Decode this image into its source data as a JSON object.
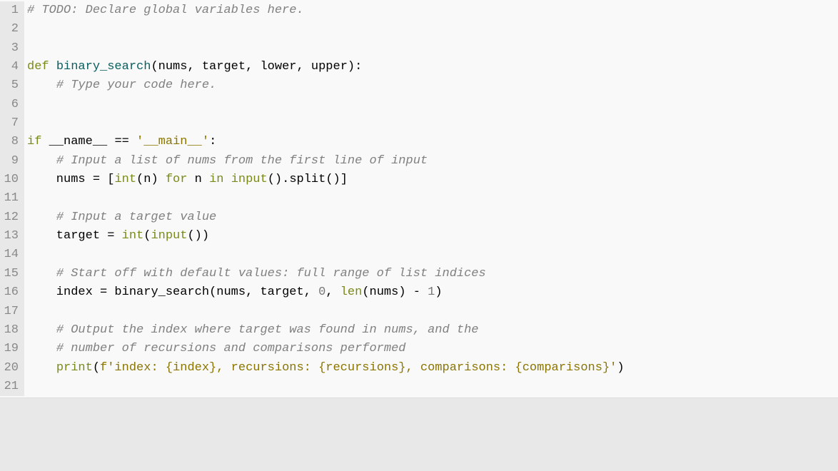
{
  "code": {
    "lines": [
      {
        "n": 1,
        "tokens": [
          [
            "comment",
            "# TODO: Declare global variables here."
          ]
        ]
      },
      {
        "n": 2,
        "tokens": []
      },
      {
        "n": 3,
        "tokens": []
      },
      {
        "n": 4,
        "tokens": [
          [
            "keyword",
            "def"
          ],
          [
            "ident",
            " "
          ],
          [
            "funcname",
            "binary_search"
          ],
          [
            "punct",
            "("
          ],
          [
            "ident",
            "nums"
          ],
          [
            "punct",
            ","
          ],
          [
            "ident",
            " target"
          ],
          [
            "punct",
            ","
          ],
          [
            "ident",
            " lower"
          ],
          [
            "punct",
            ","
          ],
          [
            "ident",
            " upper"
          ],
          [
            "punct",
            "):"
          ]
        ]
      },
      {
        "n": 5,
        "tokens": [
          [
            "ident",
            "    "
          ],
          [
            "comment",
            "# Type your code here."
          ]
        ]
      },
      {
        "n": 6,
        "tokens": []
      },
      {
        "n": 7,
        "tokens": []
      },
      {
        "n": 8,
        "tokens": [
          [
            "keyword",
            "if"
          ],
          [
            "ident",
            " __name__ "
          ],
          [
            "op",
            "=="
          ],
          [
            "ident",
            " "
          ],
          [
            "string",
            "'__main__'"
          ],
          [
            "punct",
            ":"
          ]
        ]
      },
      {
        "n": 9,
        "tokens": [
          [
            "ident",
            "    "
          ],
          [
            "comment",
            "# Input a list of nums from the first line of input"
          ]
        ]
      },
      {
        "n": 10,
        "tokens": [
          [
            "ident",
            "    nums "
          ],
          [
            "op",
            "="
          ],
          [
            "ident",
            " "
          ],
          [
            "punct",
            "["
          ],
          [
            "builtin",
            "int"
          ],
          [
            "punct",
            "("
          ],
          [
            "ident",
            "n"
          ],
          [
            "punct",
            ")"
          ],
          [
            "ident",
            " "
          ],
          [
            "keyword",
            "for"
          ],
          [
            "ident",
            " n "
          ],
          [
            "keyword",
            "in"
          ],
          [
            "ident",
            " "
          ],
          [
            "builtin",
            "input"
          ],
          [
            "punct",
            "()."
          ],
          [
            "ident",
            "split"
          ],
          [
            "punct",
            "()]"
          ]
        ]
      },
      {
        "n": 11,
        "tokens": []
      },
      {
        "n": 12,
        "tokens": [
          [
            "ident",
            "    "
          ],
          [
            "comment",
            "# Input a target value"
          ]
        ]
      },
      {
        "n": 13,
        "tokens": [
          [
            "ident",
            "    target "
          ],
          [
            "op",
            "="
          ],
          [
            "ident",
            " "
          ],
          [
            "builtin",
            "int"
          ],
          [
            "punct",
            "("
          ],
          [
            "builtin",
            "input"
          ],
          [
            "punct",
            "())"
          ]
        ]
      },
      {
        "n": 14,
        "tokens": []
      },
      {
        "n": 15,
        "tokens": [
          [
            "ident",
            "    "
          ],
          [
            "comment",
            "# Start off with default values: full range of list indices"
          ]
        ]
      },
      {
        "n": 16,
        "tokens": [
          [
            "ident",
            "    index "
          ],
          [
            "op",
            "="
          ],
          [
            "ident",
            " binary_search"
          ],
          [
            "punct",
            "("
          ],
          [
            "ident",
            "nums"
          ],
          [
            "punct",
            ","
          ],
          [
            "ident",
            " target"
          ],
          [
            "punct",
            ","
          ],
          [
            "ident",
            " "
          ],
          [
            "number",
            "0"
          ],
          [
            "punct",
            ","
          ],
          [
            "ident",
            " "
          ],
          [
            "builtin",
            "len"
          ],
          [
            "punct",
            "("
          ],
          [
            "ident",
            "nums"
          ],
          [
            "punct",
            ")"
          ],
          [
            "ident",
            " "
          ],
          [
            "op",
            "-"
          ],
          [
            "ident",
            " "
          ],
          [
            "number",
            "1"
          ],
          [
            "punct",
            ")"
          ]
        ]
      },
      {
        "n": 17,
        "tokens": []
      },
      {
        "n": 18,
        "tokens": [
          [
            "ident",
            "    "
          ],
          [
            "comment",
            "# Output the index where target was found in nums, and the"
          ]
        ]
      },
      {
        "n": 19,
        "tokens": [
          [
            "ident",
            "    "
          ],
          [
            "comment",
            "# number of recursions and comparisons performed"
          ]
        ]
      },
      {
        "n": 20,
        "tokens": [
          [
            "ident",
            "    "
          ],
          [
            "builtin",
            "print"
          ],
          [
            "punct",
            "("
          ],
          [
            "string",
            "f'index: {index}, recursions: {recursions}, comparisons: {comparisons}'"
          ],
          [
            "punct",
            ")"
          ]
        ]
      },
      {
        "n": 21,
        "tokens": []
      }
    ]
  }
}
